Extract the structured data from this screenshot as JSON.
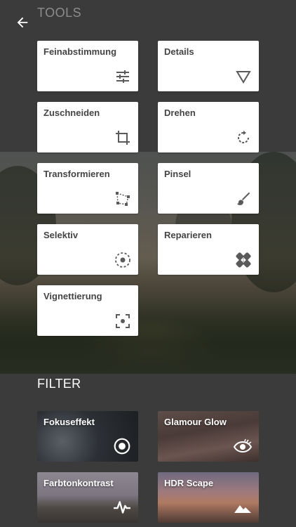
{
  "header": {
    "back_icon": "arrow-left-icon",
    "tools_title": "TOOLS"
  },
  "tools": [
    {
      "label": "Feinabstimmung",
      "icon": "sliders-icon"
    },
    {
      "label": "Details",
      "icon": "triangle-down-icon"
    },
    {
      "label": "Zuschneiden",
      "icon": "crop-icon"
    },
    {
      "label": "Drehen",
      "icon": "rotate-icon"
    },
    {
      "label": "Transformieren",
      "icon": "transform-icon"
    },
    {
      "label": "Pinsel",
      "icon": "brush-icon"
    },
    {
      "label": "Selektiv",
      "icon": "selective-target-icon"
    },
    {
      "label": "Reparieren",
      "icon": "healing-bandage-icon"
    },
    {
      "label": "Vignettierung",
      "icon": "vignette-focus-icon"
    }
  ],
  "filter_title": "FILTER",
  "filters": [
    {
      "label": "Fokuseffekt",
      "icon": "focus-circle-icon"
    },
    {
      "label": "Glamour Glow",
      "icon": "eye-icon"
    },
    {
      "label": "Farbtonkontrast",
      "icon": "pulse-icon"
    },
    {
      "label": "HDR Scape",
      "icon": "mountains-icon"
    }
  ],
  "colors": {
    "background": "#3b3b3b",
    "card": "#ffffff",
    "card_text": "#444444",
    "icon": "#5a5a5a",
    "section_tools": "#8c8c8c",
    "section_filter": "#ffffff"
  }
}
